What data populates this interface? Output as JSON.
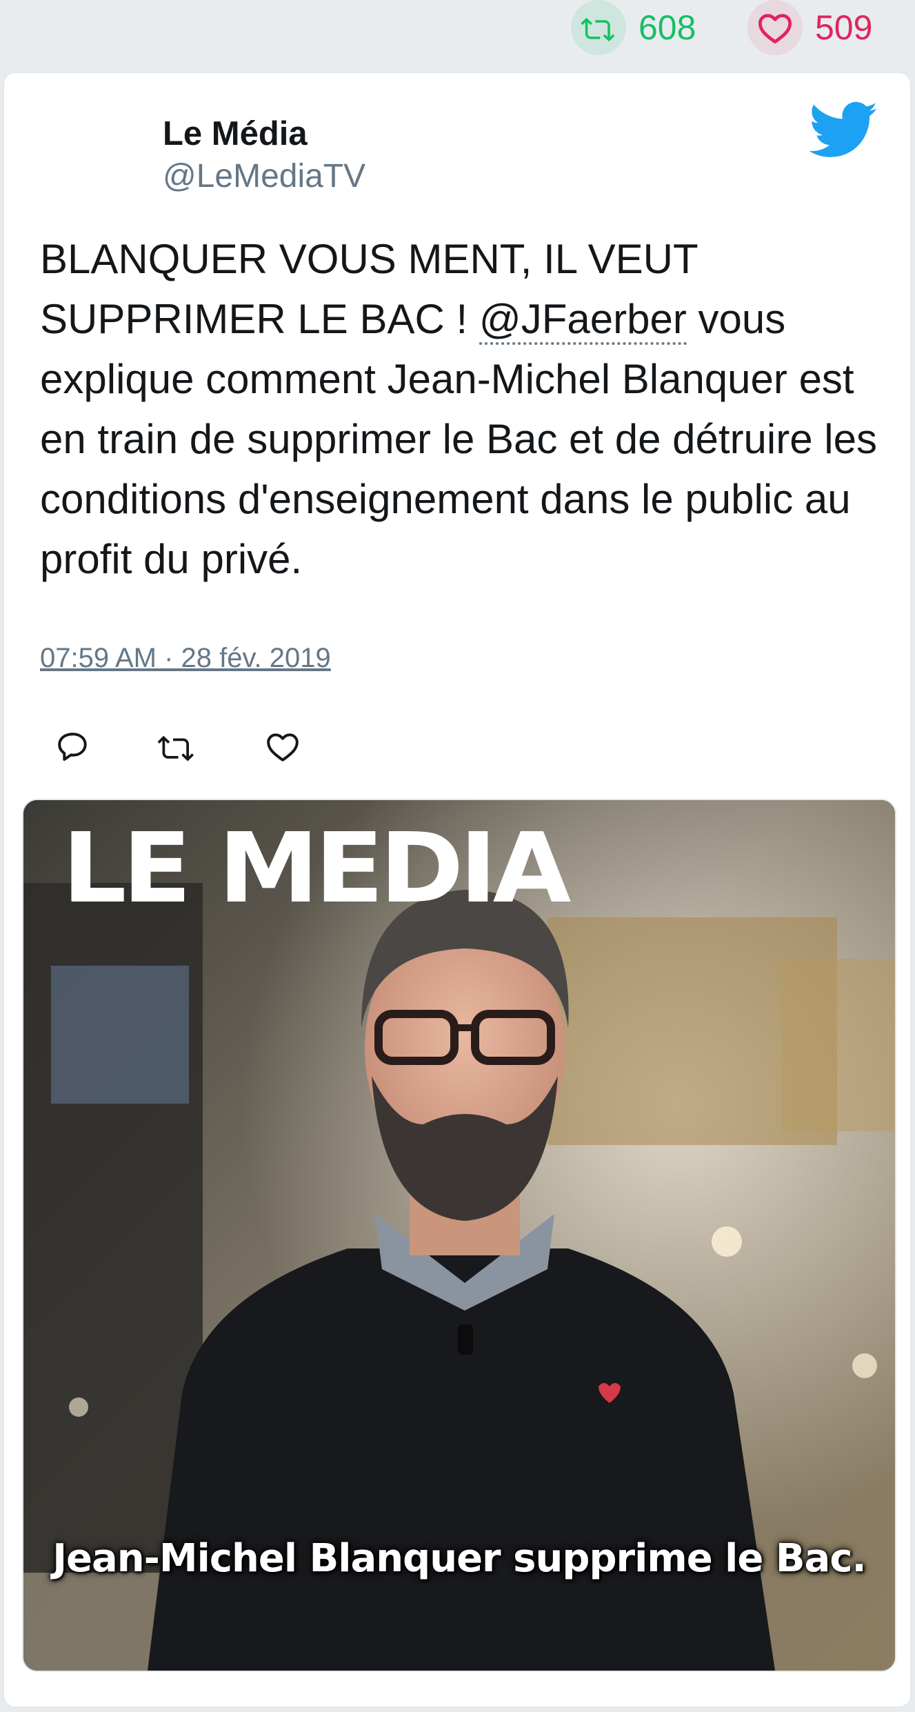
{
  "stats": {
    "retweet_count": "608",
    "like_count": "509"
  },
  "tweet": {
    "author_name": "Le Média",
    "author_handle": "@LeMediaTV",
    "text_before_mention": "BLANQUER VOUS MENT, IL VEUT SUPPRIMER LE BAC ! ",
    "mention": "@JFaerber",
    "text_after_mention": " vous explique comment Jean-Michel Blanquer est en train de supprimer le Bac et de détruire les conditions d'enseignement dans le public au profit du privé.",
    "timestamp": "07:59 AM · 28 fév. 2019"
  },
  "media": {
    "logo_text": "LE MEDIA",
    "caption": "Jean-Michel Blanquer supprime le Bac."
  },
  "colors": {
    "retweet_green": "#17bf63",
    "like_red": "#e0245e",
    "twitter_blue": "#1da1f2",
    "handle_gray": "#657786"
  },
  "icons": {
    "retweet": "retweet-icon",
    "like": "heart-icon",
    "logo": "twitter-bird-icon",
    "reply": "reply-icon"
  }
}
